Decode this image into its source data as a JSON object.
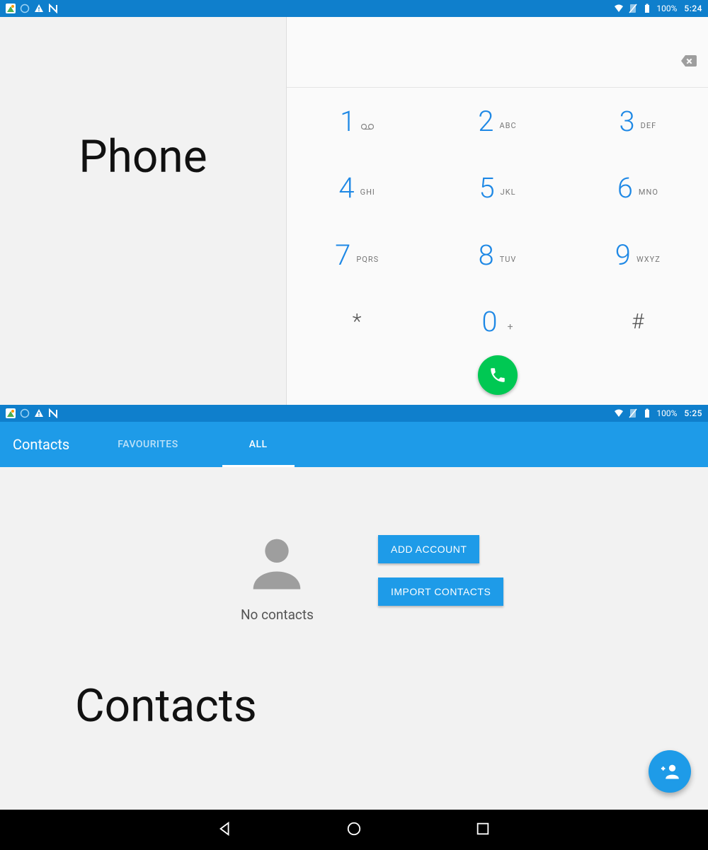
{
  "status1": {
    "battery": "100%",
    "time": "5:24"
  },
  "status2": {
    "battery": "100%",
    "time": "5:25"
  },
  "phone": {
    "label": "Phone",
    "keys": [
      {
        "digit": "1",
        "letters": ""
      },
      {
        "digit": "2",
        "letters": "ABC"
      },
      {
        "digit": "3",
        "letters": "DEF"
      },
      {
        "digit": "4",
        "letters": "GHI"
      },
      {
        "digit": "5",
        "letters": "JKL"
      },
      {
        "digit": "6",
        "letters": "MNO"
      },
      {
        "digit": "7",
        "letters": "PQRS"
      },
      {
        "digit": "8",
        "letters": "TUV"
      },
      {
        "digit": "9",
        "letters": "WXYZ"
      },
      {
        "digit": "*",
        "letters": ""
      },
      {
        "digit": "0",
        "letters": "+"
      },
      {
        "digit": "#",
        "letters": ""
      }
    ]
  },
  "contacts": {
    "title": "Contacts",
    "tabs": {
      "fav": "FAVOURITES",
      "all": "ALL"
    },
    "empty": "No contacts",
    "add_account": "ADD ACCOUNT",
    "import": "IMPORT CONTACTS",
    "label": "Contacts"
  }
}
